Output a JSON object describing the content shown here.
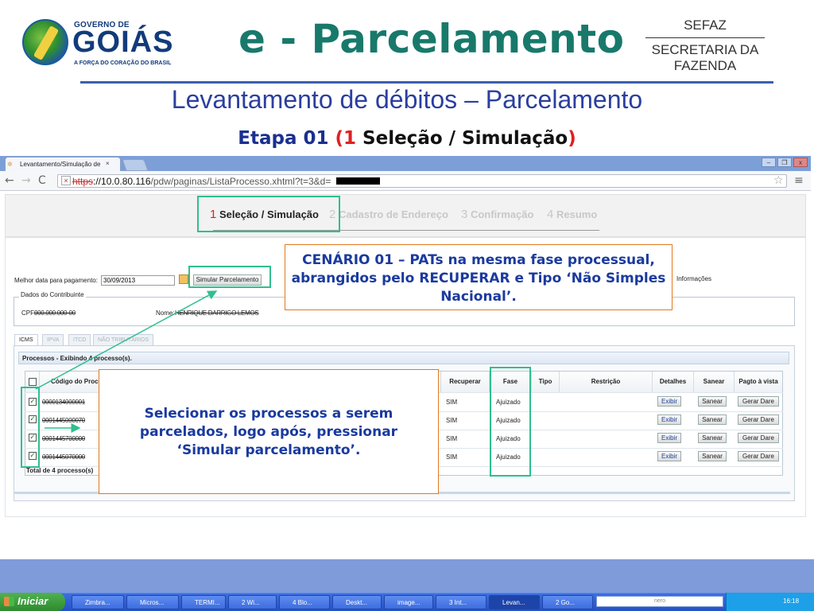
{
  "slide": {
    "logo_line1": "GOVERNO DE",
    "logo_line2": "GOIÁS",
    "logo_tagline": "A FORÇA DO CORAÇÃO DO BRASIL",
    "title": "e - Parcelamento",
    "sefaz": "SEFAZ",
    "sefaz_line2": "SECRETARIA DA",
    "sefaz_line3": "FAZENDA",
    "subtitle": "Levantamento de débitos – Parcelamento",
    "etapa_prefix": "Etapa 01 ",
    "etapa_open": "(",
    "etapa_num": "1",
    "etapa_text": " Seleção / Simulação",
    "etapa_close": ")"
  },
  "browser": {
    "tab_title": "Levantamento/Simulação de",
    "tab_close": "×",
    "url_scheme": "https",
    "url_host": "://10.0.80.116",
    "url_path": "/pdw/paginas/ListaProcesso.xhtml?t=3&d=",
    "win_buttons": [
      "–",
      "❐",
      "x"
    ]
  },
  "wizard": {
    "steps": [
      {
        "num": "1",
        "label": "Seleção / Simulação",
        "active": true
      },
      {
        "num": "2",
        "label": "Cadastro de Endereço",
        "active": false
      },
      {
        "num": "3",
        "label": "Confirmação",
        "active": false
      },
      {
        "num": "4",
        "label": "Resumo",
        "active": false
      }
    ]
  },
  "form": {
    "best_date_label": "Melhor data para pagamento:",
    "best_date_value": "30/09/2013",
    "simulate_button": "Simular Parcelamento",
    "info_label": "Informações",
    "contrib_legend": "Dados do Contribuinte",
    "cpf_label": "CPF:",
    "cpf_value": "000.000.000-00",
    "name_label": "Nome:",
    "name_value": "HENRIQUE DARRIGO LEMOS"
  },
  "tabs": [
    "ICMS",
    "IPVA",
    "ITCD",
    "NÃO TRIBUTÁRIOS"
  ],
  "grid": {
    "title": "Processos - Exibindo 4 processo(s).",
    "columns": [
      "Código do Processo",
      "Recuperar",
      "Fase",
      "Tipo",
      "Restrição",
      "Detalhes",
      "Sanear",
      "Pagto à vista"
    ],
    "rows": [
      {
        "codigo": "0000134000001",
        "recuperar": "SIM",
        "fase": "Ajuizado",
        "tipo": "",
        "restricao": "",
        "detalhes": "Exibir",
        "sanear": "Sanear",
        "pagto": "Gerar Dare"
      },
      {
        "codigo": "0001445000070",
        "recuperar": "SIM",
        "fase": "Ajuizado",
        "tipo": "",
        "restricao": "",
        "detalhes": "Exibir",
        "sanear": "Sanear",
        "pagto": "Gerar Dare"
      },
      {
        "codigo": "0001445700000",
        "recuperar": "SIM",
        "fase": "Ajuizado",
        "tipo": "",
        "restricao": "",
        "detalhes": "Exibir",
        "sanear": "Sanear",
        "pagto": "Gerar Dare"
      },
      {
        "codigo": "0001445070000",
        "recuperar": "SIM",
        "fase": "Ajuizado",
        "tipo": "",
        "restricao": "",
        "detalhes": "Exibir",
        "sanear": "Sanear",
        "pagto": "Gerar Dare"
      }
    ],
    "total": "Total de 4 processo(s)"
  },
  "annotations": {
    "scenario": "CENÁRIO 01 – PATs na mesma fase processual, abrangidos pelo RECUPERAR e Tipo ‘Não Simples Nacional’.",
    "instruction": "Selecionar os processos a serem parcelados, logo após, pressionar ‘Simular parcelamento’."
  },
  "taskbar": {
    "start": "Iniciar",
    "items": [
      "Zimbra...",
      "Micros...",
      "TERMI...",
      "2 Wi...",
      "4 Blo...",
      "Deskt...",
      "image...",
      "3 Int...",
      "Levan...",
      "2 Go..."
    ],
    "search_brand": "nero",
    "clock": "16:18"
  },
  "colors": {
    "title_teal": "#18796b",
    "subtitle_blue": "#2b3f9e",
    "callout_border": "#e07a20",
    "highlight_green": "#2fbf8f",
    "slide_band": "#7f9bd9"
  }
}
